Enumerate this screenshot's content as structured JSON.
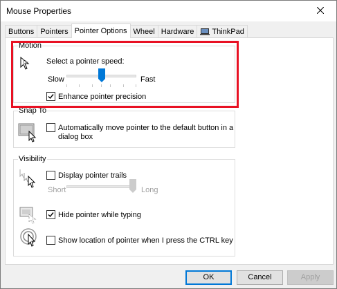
{
  "window": {
    "title": "Mouse Properties"
  },
  "tabs": [
    {
      "label": "Buttons"
    },
    {
      "label": "Pointers"
    },
    {
      "label": "Pointer Options",
      "active": true
    },
    {
      "label": "Wheel"
    },
    {
      "label": "Hardware"
    },
    {
      "label": "ThinkPad"
    }
  ],
  "motion": {
    "group_label": "Motion",
    "speed_label": "Select a pointer speed:",
    "slow_label": "Slow",
    "fast_label": "Fast",
    "speed_value": 0.5,
    "enhance_precision": {
      "label": "Enhance pointer precision",
      "checked": true
    }
  },
  "snap_to": {
    "group_label": "Snap To",
    "option": {
      "label_line1": "Automatically move pointer to the default button in a",
      "label_line2": "dialog box",
      "checked": false
    }
  },
  "visibility": {
    "group_label": "Visibility",
    "trails": {
      "label": "Display pointer trails",
      "checked": false
    },
    "trails_short": "Short",
    "trails_long": "Long",
    "trails_value": 1.0,
    "hide_while_typing": {
      "label": "Hide pointer while typing",
      "checked": true
    },
    "show_location": {
      "label": "Show location of pointer when I press the CTRL key",
      "checked": false
    }
  },
  "buttons": {
    "ok": "OK",
    "cancel": "Cancel",
    "apply": "Apply"
  },
  "colors": {
    "highlight": "#e81123",
    "accent": "#0078d7"
  }
}
